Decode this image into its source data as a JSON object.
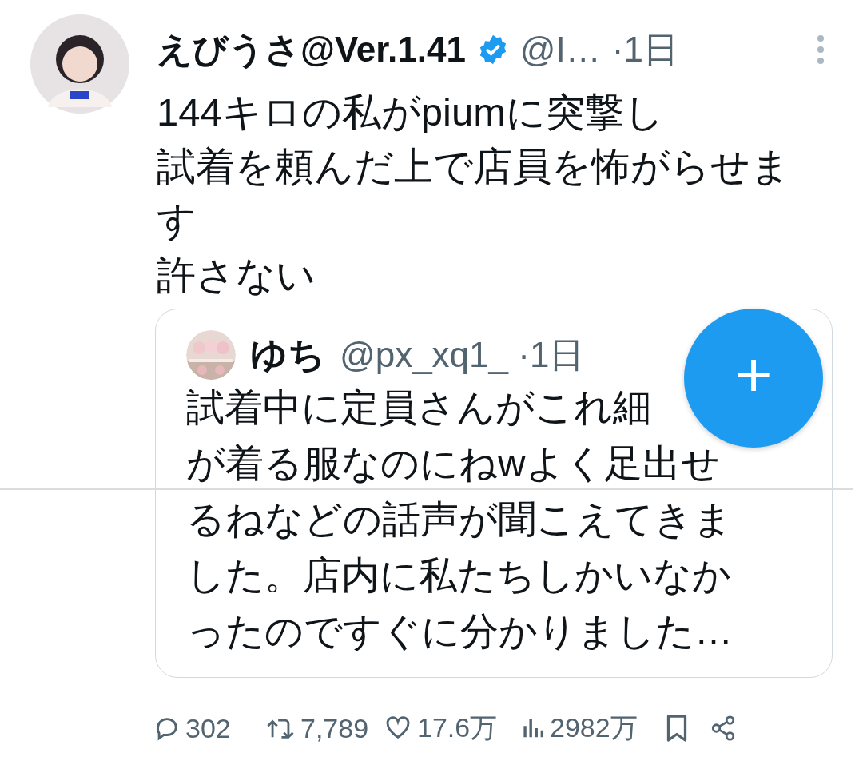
{
  "tweet": {
    "author_name": "えびうさ@Ver.1.41",
    "verified": true,
    "handle": "@I…",
    "time": "·1日",
    "body_lines": [
      "144キロの私がpiumに突撃し",
      "試着を頼んだ上で店員を怖がらせま",
      "す",
      "許さない"
    ]
  },
  "quoted_tweet": {
    "author_name": "ゆち",
    "handle": "@px_xq1_",
    "time": "·1日",
    "body_lines": [
      "試着中に定員さんがこれ細",
      "が着る服なのにねwよく足出せ",
      "るねなどの話声が聞こえてきま",
      "した。店内に私たちしかいなか",
      "ったのですぐに分かりました…"
    ]
  },
  "fab": {
    "label": "+"
  },
  "stats": [
    {
      "kind": "reply",
      "value": "302"
    },
    {
      "kind": "retweet",
      "value": "7,789"
    },
    {
      "kind": "like",
      "value": "17.6万"
    },
    {
      "kind": "views",
      "value": "2982万"
    },
    {
      "kind": "bookmark"
    },
    {
      "kind": "share"
    }
  ]
}
